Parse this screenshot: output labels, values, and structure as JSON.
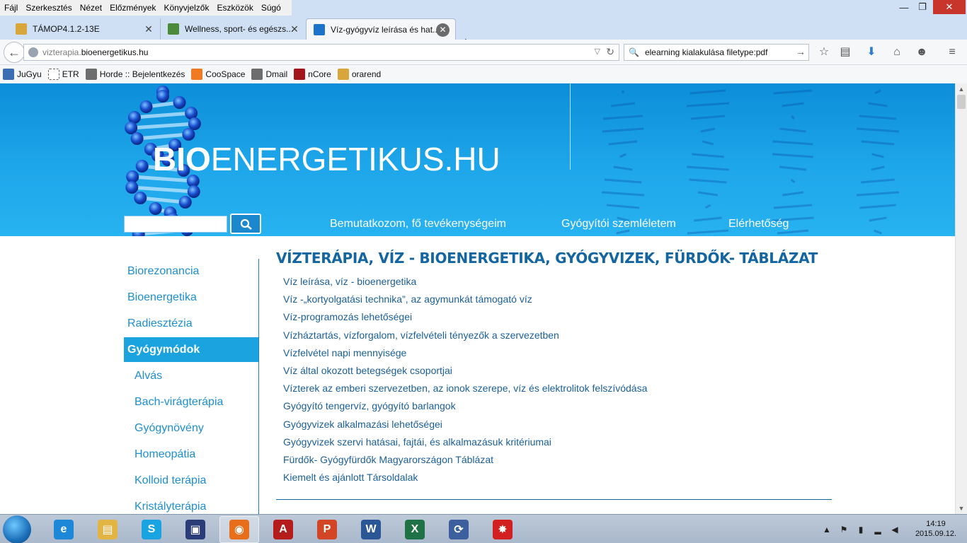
{
  "menubar": {
    "items": [
      "Fájl",
      "Szerkesztés",
      "Nézet",
      "Előzmények",
      "Könyvjelzők",
      "Eszközök",
      "Súgó"
    ],
    "min_glyph": "—",
    "max_glyph": "❐",
    "close_glyph": "✕"
  },
  "tabs": [
    {
      "title": "TÁMOP4.1.2-13E",
      "favicon_color": "#d9a63c"
    },
    {
      "title": "Wellness, sport- és egészs...",
      "favicon_color": "#4a8b3b"
    },
    {
      "title": "Víz-gyógyvíz leírása és hat...",
      "favicon_color": "#1c73c9"
    }
  ],
  "tab_close_glyph": "✕",
  "new_tab_glyph": "+",
  "navbar": {
    "url_prefix": "vizterapia.",
    "url_domain": "bioenergetikus.hu",
    "search_query": "elearning kialakulása filetype:pdf"
  },
  "bookmarks": [
    {
      "label": "JuGyu",
      "color": "#3b6fb3"
    },
    {
      "label": "ETR",
      "color": "#ffffff"
    },
    {
      "label": "Horde :: Bejelentkezés",
      "color": "#6d6d6d"
    },
    {
      "label": "CooSpace",
      "color": "#f07a22"
    },
    {
      "label": "Dmail",
      "color": "#6d6d6d"
    },
    {
      "label": "nCore",
      "color": "#a3151a"
    },
    {
      "label": "orarend",
      "color": "#d9a63c"
    }
  ],
  "site": {
    "title_bold": "BIO",
    "title_rest": "ENERGETIKUS.HU",
    "search_value": "",
    "nav": [
      "Bemutatkozom, fő tevékenységeim",
      "Gyógyítói szemléletem",
      "Elérhetőség"
    ],
    "sidebar": [
      {
        "label": "Biorezonancia",
        "active": false,
        "sub": false
      },
      {
        "label": "Bioenergetika",
        "active": false,
        "sub": false
      },
      {
        "label": "Radiesztézia",
        "active": false,
        "sub": false
      },
      {
        "label": "Gyógymódok",
        "active": true,
        "sub": false
      },
      {
        "label": "Alvás",
        "active": false,
        "sub": true
      },
      {
        "label": "Bach-virágterápia",
        "active": false,
        "sub": true
      },
      {
        "label": "Gyógynövény",
        "active": false,
        "sub": true
      },
      {
        "label": "Homeopátia",
        "active": false,
        "sub": true
      },
      {
        "label": "Kolloid terápia",
        "active": false,
        "sub": true
      },
      {
        "label": "Kristályterápia",
        "active": false,
        "sub": true
      }
    ],
    "content_title": "VÍZTERÁPIA, VÍZ - BIOENERGETIKA, GYÓGYVIZEK, FÜRDŐK- TÁBLÁZAT",
    "links": [
      "Víz leírása, víz - bioenergetika",
      "Víz -„kortyolgatási technika”, az agymunkát támogató víz",
      "Víz-programozás lehetőségei",
      "Vízháztartás, vízforgalom, vízfelvételi tényezők a szervezetben",
      "Vízfelvétel napi mennyisége",
      "Víz által okozott betegségek csoportjai",
      "Vízterek az emberi szervezetben, az ionok szerepe, víz és elektrolitok felszívódása",
      "Gyógyító tengervíz, gyógyító barlangok",
      "Gyógyvizek alkalmazási lehetőségei",
      "Gyógyvizek szervi hatásai, fajtái, és alkalmazásuk kritériumai",
      "Fürdők- Gyógyfürdők Magyarországon Táblázat",
      "Kiemelt és ajánlott Társoldalak"
    ],
    "colors": {
      "banner": "#1ea6ea",
      "active_menu": "#1aa3df",
      "heading": "#1466a0",
      "link": "#1a5f99",
      "side_link": "#1d8fd0"
    }
  },
  "taskbar": {
    "apps": [
      {
        "name": "internet-explorer",
        "glyph": "e",
        "color": "#1e88d8",
        "active": false
      },
      {
        "name": "file-explorer",
        "glyph": "▤",
        "color": "#e2b443",
        "active": false
      },
      {
        "name": "skype",
        "glyph": "S",
        "color": "#19a3e0",
        "active": false
      },
      {
        "name": "save-utility",
        "glyph": "▣",
        "color": "#2a3d78",
        "active": false
      },
      {
        "name": "firefox",
        "glyph": "◉",
        "color": "#e76e1b",
        "active": true
      },
      {
        "name": "acrobat",
        "glyph": "A",
        "color": "#b51d1d",
        "active": false
      },
      {
        "name": "powerpoint",
        "glyph": "P",
        "color": "#d24625",
        "active": false
      },
      {
        "name": "word",
        "glyph": "W",
        "color": "#2b5797",
        "active": false
      },
      {
        "name": "excel",
        "glyph": "X",
        "color": "#1f7246",
        "active": false
      },
      {
        "name": "sync-app",
        "glyph": "⟳",
        "color": "#3d5f9e",
        "active": false
      },
      {
        "name": "paint-app",
        "glyph": "✸",
        "color": "#d21f1f",
        "active": false
      }
    ],
    "time": "14:19",
    "date": "2015.09.12."
  }
}
